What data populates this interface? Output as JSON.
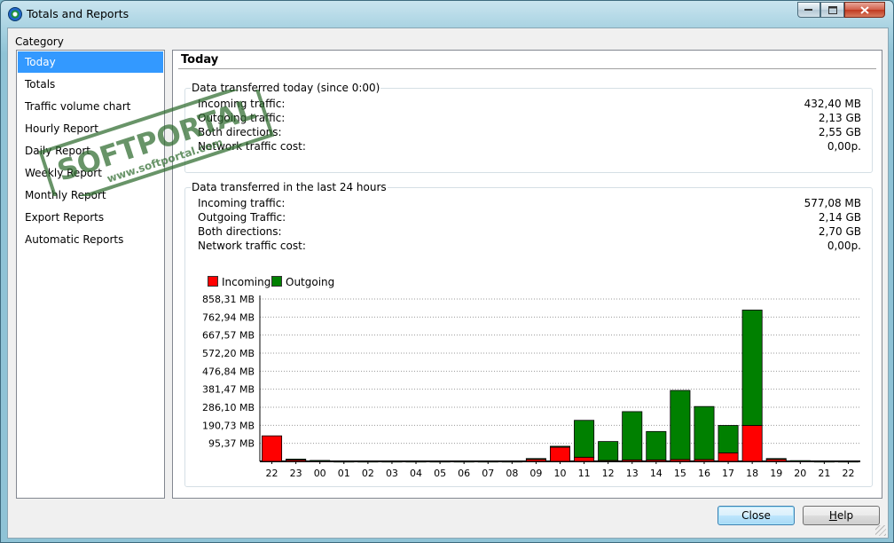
{
  "window": {
    "title": "Totals and Reports"
  },
  "category": {
    "label": "Category",
    "items": [
      "Today",
      "Totals",
      "Traffic volume chart",
      "Hourly Report",
      "Daily Report",
      "Weekly Report",
      "Monthly Report",
      "Export Reports",
      "Automatic Reports"
    ],
    "selected": "Today"
  },
  "panel": {
    "title": "Today",
    "today_group": {
      "title": "Data transferred today (since 0:00)",
      "rows": [
        {
          "label": "Incoming traffic:",
          "value": "432,40 MB"
        },
        {
          "label": "Outgoing traffic:",
          "value": "2,13 GB"
        },
        {
          "label": "Both directions:",
          "value": "2,55 GB"
        },
        {
          "label": "Network traffic cost:",
          "value": "0,00p."
        }
      ]
    },
    "last24_group": {
      "title": "Data transferred in the last 24 hours",
      "rows": [
        {
          "label": "Incoming traffic:",
          "value": "577,08 MB"
        },
        {
          "label": "Outgoing Traffic:",
          "value": "2,14 GB"
        },
        {
          "label": "Both directions:",
          "value": "2,70 GB"
        },
        {
          "label": "Network traffic cost:",
          "value": "0,00p."
        }
      ]
    }
  },
  "chart_data": {
    "type": "bar",
    "stacked": true,
    "categories": [
      "22",
      "23",
      "00",
      "01",
      "02",
      "03",
      "04",
      "05",
      "06",
      "07",
      "08",
      "09",
      "10",
      "11",
      "12",
      "13",
      "14",
      "15",
      "16",
      "17",
      "18",
      "19",
      "20",
      "21",
      "22"
    ],
    "series": [
      {
        "name": "Incoming",
        "color": "#ff0000",
        "values": [
          135,
          10,
          2,
          1,
          1,
          1,
          1,
          1,
          1,
          1,
          1,
          12,
          75,
          22,
          5,
          8,
          8,
          10,
          10,
          45,
          190,
          12,
          2,
          1,
          1
        ]
      },
      {
        "name": "Outgoing",
        "color": "#008000",
        "values": [
          0,
          2,
          3,
          1,
          1,
          1,
          1,
          1,
          1,
          1,
          1,
          3,
          5,
          195,
          100,
          255,
          150,
          365,
          280,
          145,
          610,
          3,
          2,
          1,
          1
        ]
      }
    ],
    "yticks": [
      "95,37 MB",
      "190,73 MB",
      "286,10 MB",
      "381,47 MB",
      "476,84 MB",
      "572,20 MB",
      "667,57 MB",
      "762,94 MB",
      "858,31 MB"
    ],
    "ylim": [
      0,
      858.31
    ],
    "legend": "top-left",
    "grid": true
  },
  "buttons": {
    "close": "Close",
    "help_prefix": "H",
    "help_rest": "elp"
  },
  "watermark": {
    "brand": "SOFTPORTAL",
    "url": "www.softportal.com"
  }
}
